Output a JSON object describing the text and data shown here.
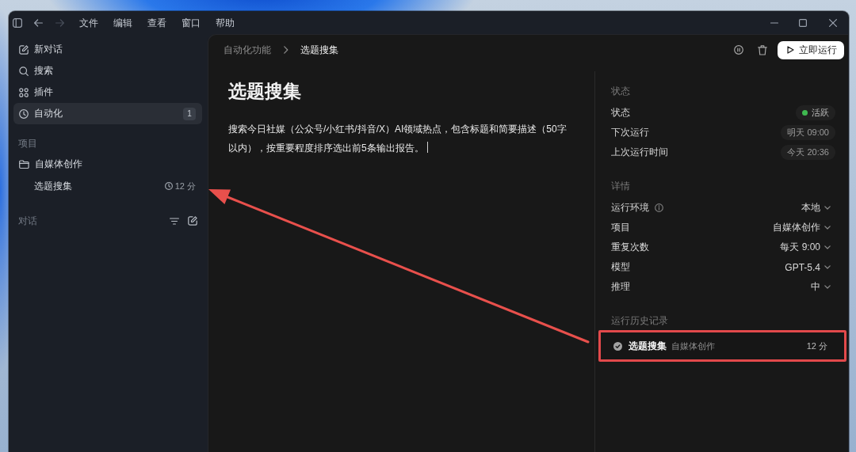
{
  "titlebar": {
    "back": {
      "disabled": false
    },
    "forward": {
      "disabled": true
    },
    "menu": [
      "文件",
      "编辑",
      "查看",
      "窗口",
      "帮助"
    ]
  },
  "sidebar": {
    "nav": [
      {
        "label": "新对话",
        "selected": false
      },
      {
        "label": "搜索",
        "selected": false
      },
      {
        "label": "插件",
        "selected": false
      },
      {
        "label": "自动化",
        "selected": true,
        "badge": "1"
      }
    ],
    "projects": {
      "title": "项目",
      "items": [
        {
          "label": "自媒体创作",
          "selected": false,
          "children": [
            {
              "label": "选题搜集",
              "time": "12 分",
              "selected": false
            }
          ]
        }
      ]
    },
    "conversations": {
      "title": "对话"
    }
  },
  "main": {
    "breadcrumb": [
      "自动化功能",
      "选题搜集"
    ],
    "run_button": "立即运行",
    "title": "选题搜集",
    "prompt": "搜索今日社媒（公众号/小红书/抖音/X）AI领域热点，包含标题和简要描述（50字以内），按重要程度排序选出前5条输出报告。"
  },
  "details": {
    "sections": [
      {
        "title": "状态",
        "rows": [
          {
            "kind": "status",
            "label": "状态",
            "value": "活跃"
          },
          {
            "kind": "pill",
            "label": "下次运行",
            "value": "明天 09:00"
          },
          {
            "kind": "pill",
            "label": "上次运行时间",
            "value": "今天 20:36"
          }
        ]
      },
      {
        "title": "详情",
        "rows": [
          {
            "kind": "dropdown",
            "label": "运行环境",
            "info": true,
            "value": "本地"
          },
          {
            "kind": "dropdown",
            "label": "项目",
            "value": "自媒体创作"
          },
          {
            "kind": "dropdown",
            "label": "重复次数",
            "value": "每天 9:00"
          },
          {
            "kind": "dropdown",
            "label": "模型",
            "value": "GPT-5.4"
          },
          {
            "kind": "dropdown",
            "label": "推理",
            "value": "中"
          }
        ]
      }
    ]
  },
  "history": {
    "title": "运行历史记录",
    "items": [
      {
        "title": "选题搜集",
        "project": "自媒体创作",
        "time": "12 分",
        "highlighted": true
      }
    ]
  }
}
